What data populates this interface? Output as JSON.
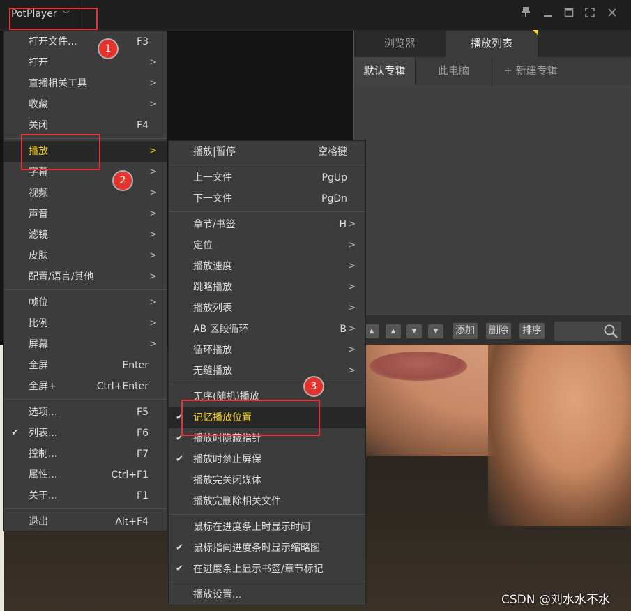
{
  "app": {
    "title": "PotPlayer"
  },
  "window_controls": [
    {
      "name": "pin-icon",
      "glyph": "▴"
    },
    {
      "name": "minimize-icon",
      "glyph": "—"
    },
    {
      "name": "maximize-icon",
      "glyph": "□"
    },
    {
      "name": "fullscreen-icon",
      "glyph": "⤢"
    },
    {
      "name": "close-icon",
      "glyph": "✕"
    }
  ],
  "panel": {
    "tabs": [
      "浏览器",
      "播放列表"
    ],
    "subtabs": [
      "默认专辑",
      "此电脑",
      "+ 新建专辑"
    ],
    "buttons": {
      "add": "添加",
      "delete": "删除",
      "sort": "排序"
    }
  },
  "main_menu": {
    "items": [
      {
        "label": "打开文件...",
        "shortcut": "F3"
      },
      {
        "label": "打开",
        "submenu": true
      },
      {
        "label": "直播相关工具",
        "submenu": true
      },
      {
        "label": "收藏",
        "submenu": true
      },
      {
        "label": "关闭",
        "shortcut": "F4"
      },
      {
        "label": "播放",
        "submenu": true,
        "highlighted": true
      },
      {
        "label": "字幕",
        "submenu": true
      },
      {
        "label": "视频",
        "submenu": true
      },
      {
        "label": "声音",
        "submenu": true
      },
      {
        "label": "滤镜",
        "submenu": true
      },
      {
        "label": "皮肤",
        "submenu": true
      },
      {
        "label": "配置/语言/其他",
        "submenu": true
      },
      {
        "label": "帧位",
        "submenu": true
      },
      {
        "label": "比例",
        "submenu": true
      },
      {
        "label": "屏幕",
        "submenu": true
      },
      {
        "label": "全屏",
        "shortcut": "Enter"
      },
      {
        "label": "全屏+",
        "shortcut": "Ctrl+Enter"
      },
      {
        "label": "选项...",
        "shortcut": "F5"
      },
      {
        "label": "列表...",
        "shortcut": "F6",
        "checked": true
      },
      {
        "label": "控制...",
        "shortcut": "F7"
      },
      {
        "label": "属性...",
        "shortcut": "Ctrl+F1"
      },
      {
        "label": "关于...",
        "shortcut": "F1"
      },
      {
        "label": "退出",
        "shortcut": "Alt+F4"
      }
    ]
  },
  "play_menu": {
    "items": [
      {
        "label": "播放|暂停",
        "shortcut": "空格键"
      },
      {
        "label": "上一文件",
        "shortcut": "PgUp"
      },
      {
        "label": "下一文件",
        "shortcut": "PgDn"
      },
      {
        "label": "章节/书签",
        "shortcut": "H",
        "submenu": true
      },
      {
        "label": "定位",
        "submenu": true
      },
      {
        "label": "播放速度",
        "submenu": true
      },
      {
        "label": "跳略播放",
        "submenu": true
      },
      {
        "label": "播放列表",
        "submenu": true
      },
      {
        "label": "AB 区段循环",
        "shortcut": "B",
        "submenu": true
      },
      {
        "label": "循环播放",
        "submenu": true
      },
      {
        "label": "无缝播放",
        "submenu": true
      },
      {
        "label": "无序(随机)播放"
      },
      {
        "label": "记忆播放位置",
        "checked": true,
        "highlighted": true
      },
      {
        "label": "播放时隐藏指针",
        "checked": true
      },
      {
        "label": "播放时禁止屏保",
        "checked": true
      },
      {
        "label": "播放完关闭媒体"
      },
      {
        "label": "播放完删除相关文件"
      },
      {
        "label": "鼠标在进度条上时显示时间"
      },
      {
        "label": "鼠标指向进度条时显示缩略图",
        "checked": true
      },
      {
        "label": "在进度条上显示书签/章节标记",
        "checked": true
      },
      {
        "label": "播放设置..."
      }
    ]
  },
  "annotations": [
    "1",
    "2",
    "3"
  ],
  "watermark": "CSDN @刘水水不水",
  "colors": {
    "highlight_text": "#f3d11e",
    "annotation_red": "#e8323a"
  }
}
